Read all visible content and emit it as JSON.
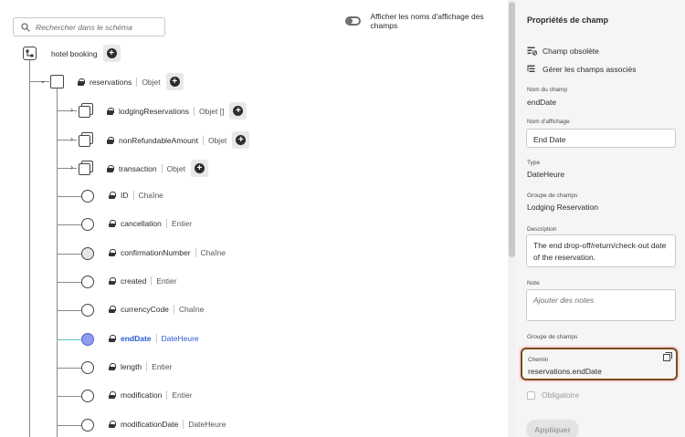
{
  "search": {
    "placeholder": "Rechercher dans le schéma"
  },
  "display_names_toggle": {
    "label": "Afficher les noms d'affichage des champs",
    "checked": false
  },
  "tree": {
    "root": {
      "name": "hotel booking"
    },
    "reservations": {
      "name": "reservations",
      "type": "Objet"
    },
    "children": [
      {
        "name": "lodgingReservations",
        "type": "Objet []"
      },
      {
        "name": "nonRefundableAmount",
        "type": "Objet"
      },
      {
        "name": "transaction",
        "type": "Objet"
      },
      {
        "name": "ID",
        "type": "Chaîne"
      },
      {
        "name": "cancellation",
        "type": "Entier"
      },
      {
        "name": "confirmationNumber",
        "type": "Chaîne"
      },
      {
        "name": "created",
        "type": "Entier"
      },
      {
        "name": "currencyCode",
        "type": "Chaîne"
      },
      {
        "name": "endDate",
        "type": "DateHeure"
      },
      {
        "name": "length",
        "type": "Entier"
      },
      {
        "name": "modification",
        "type": "Entier"
      },
      {
        "name": "modificationDate",
        "type": "DateHeure"
      }
    ]
  },
  "panel": {
    "title": "Propriétés de champ",
    "deprecate_label": "Champ obsolète",
    "manage_related_label": "Gérer les champs associés",
    "field_name_label": "Nom du champ",
    "field_name_value": "endDate",
    "display_name_label": "Nom d'affichage",
    "display_name_value": "End Date",
    "type_label": "Type",
    "type_value": "DateHeure",
    "field_group_label": "Groupe de champs",
    "field_group_value": "Lodging Reservation",
    "description_label": "Description",
    "description_value": "The end drop-off/return/check-out date of the reservation.",
    "note_label": "Note",
    "note_placeholder": "Ajouter des notes",
    "field_group_label_2": "Groupe de champs",
    "path_label": "Chemin",
    "path_value": "reservations.endDate",
    "required_label": "Obligatoire",
    "apply_label": "Appliquer"
  }
}
